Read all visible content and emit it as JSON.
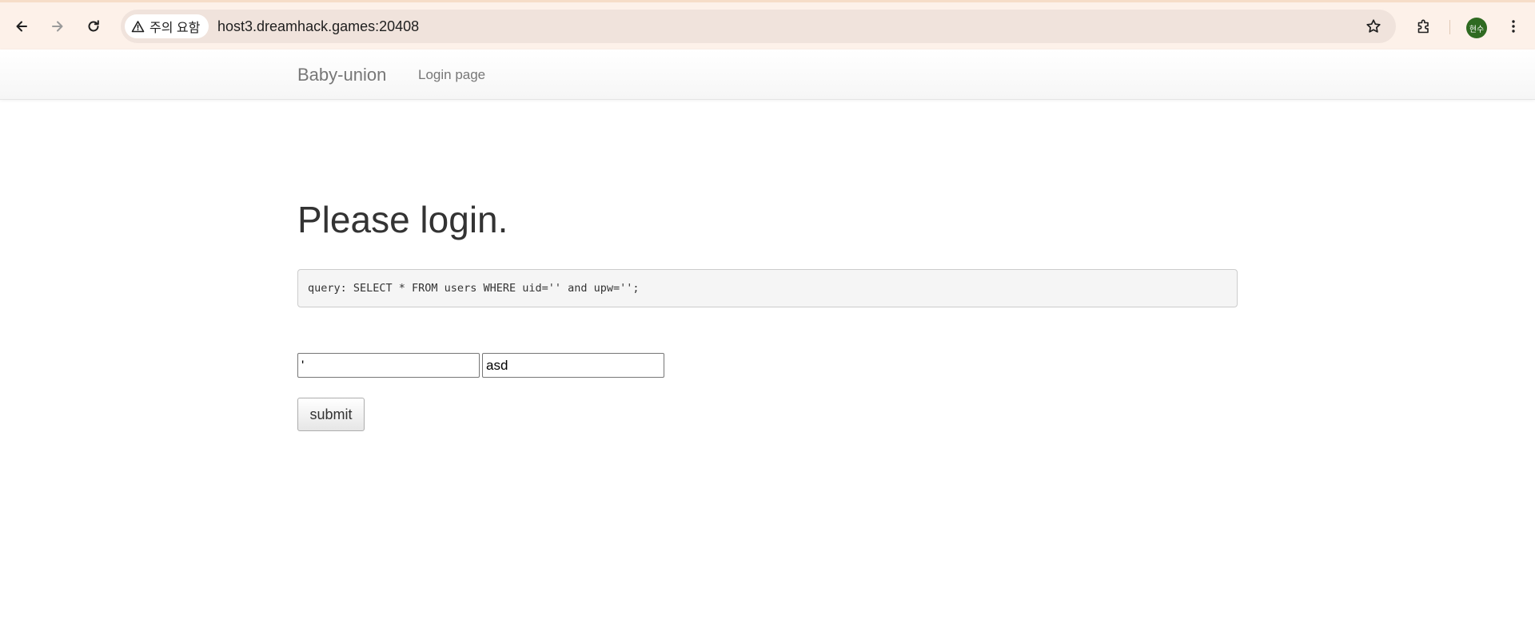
{
  "browser": {
    "security_label": "주의 요함",
    "url": "host3.dreamhack.games:20408",
    "profile_initials": "현수",
    "icons": {
      "back": "arrow-left-icon",
      "forward": "arrow-right-icon",
      "reload": "reload-icon",
      "warning": "warning-triangle-icon",
      "bookmark": "star-icon",
      "extensions": "puzzle-icon",
      "menu": "kebab-menu-icon"
    }
  },
  "navbar": {
    "brand": "Baby-union",
    "link": "Login page"
  },
  "main": {
    "heading": "Please login.",
    "query": "query: SELECT * FROM users WHERE uid='' and upw='';",
    "uid_value": "'",
    "upw_value": "asd",
    "submit_label": "submit"
  },
  "colors": {
    "chrome_bg": "#fdf1e9",
    "omnibox_bg": "#f0e3dc",
    "avatar_bg": "#2f6a21",
    "heading_text": "#333333",
    "query_bg": "#f5f5f5"
  }
}
